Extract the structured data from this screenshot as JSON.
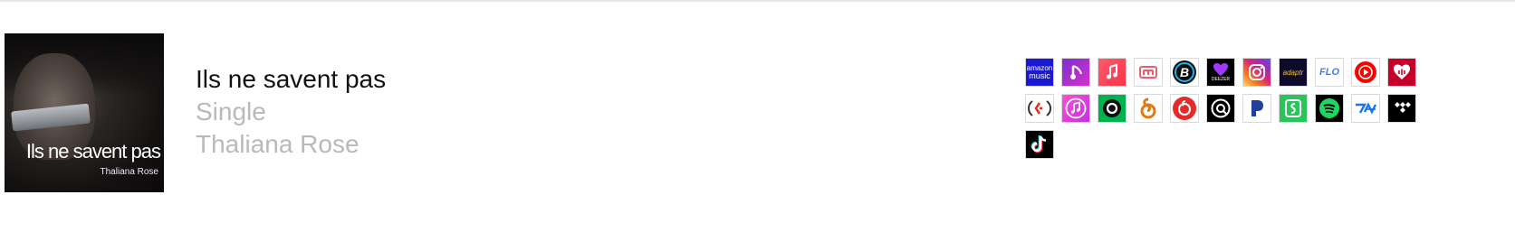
{
  "release": {
    "title": "Ils ne savent pas",
    "type": "Single",
    "artist": "Thaliana Rose"
  },
  "cover": {
    "title_text": "Ils ne savent pas",
    "artist_text": "Thaliana Rose"
  },
  "stores": [
    {
      "name": "amazon-music",
      "label_line1": "amazon",
      "label_line2": "music"
    },
    {
      "name": "anghami"
    },
    {
      "name": "apple-music"
    },
    {
      "name": "awa"
    },
    {
      "name": "boomplay"
    },
    {
      "name": "deezer",
      "label": "DEEZER"
    },
    {
      "name": "instagram"
    },
    {
      "name": "adaptr",
      "label": "adaptr"
    },
    {
      "name": "flo",
      "label": "FLO"
    },
    {
      "name": "youtube-music"
    },
    {
      "name": "iheartradio"
    },
    {
      "name": "kkbox"
    },
    {
      "name": "itunes"
    },
    {
      "name": "joox"
    },
    {
      "name": "kugou"
    },
    {
      "name": "netease"
    },
    {
      "name": "napster"
    },
    {
      "name": "pandora"
    },
    {
      "name": "jiosaavn"
    },
    {
      "name": "spotify"
    },
    {
      "name": "tencent"
    },
    {
      "name": "tidal"
    },
    {
      "name": "tiktok"
    }
  ]
}
